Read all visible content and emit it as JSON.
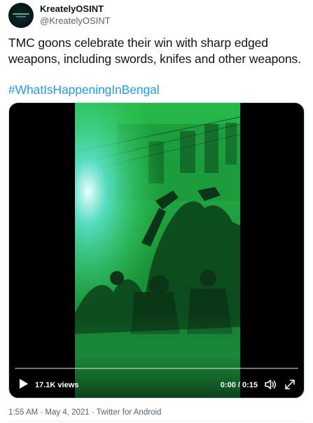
{
  "author": {
    "display_name": "KreatelyOSINT",
    "handle": "@KreatelyOSINT",
    "avatar_icon": "kreately-logo-avatar"
  },
  "tweet": {
    "text": "TMC goons celebrate their win with sharp edged weapons, including swords, knifes and other weapons.",
    "hashtag": "#WhatIsHappeningInBengal"
  },
  "video": {
    "views": "17.1K views",
    "time": "0:00 / 0:15",
    "progress": 0,
    "play_icon": "play-icon",
    "volume_icon": "volume-icon",
    "fullscreen_icon": "fullscreen-icon"
  },
  "meta": {
    "timestamp_text": "1:55 AM · May 4, 2021 · Twitter for Android"
  },
  "colors": {
    "text": "#0f1419",
    "secondary": "#536471",
    "link": "#1d9bf0",
    "video_bg": "#000000",
    "video_green": "#2fd14a"
  }
}
